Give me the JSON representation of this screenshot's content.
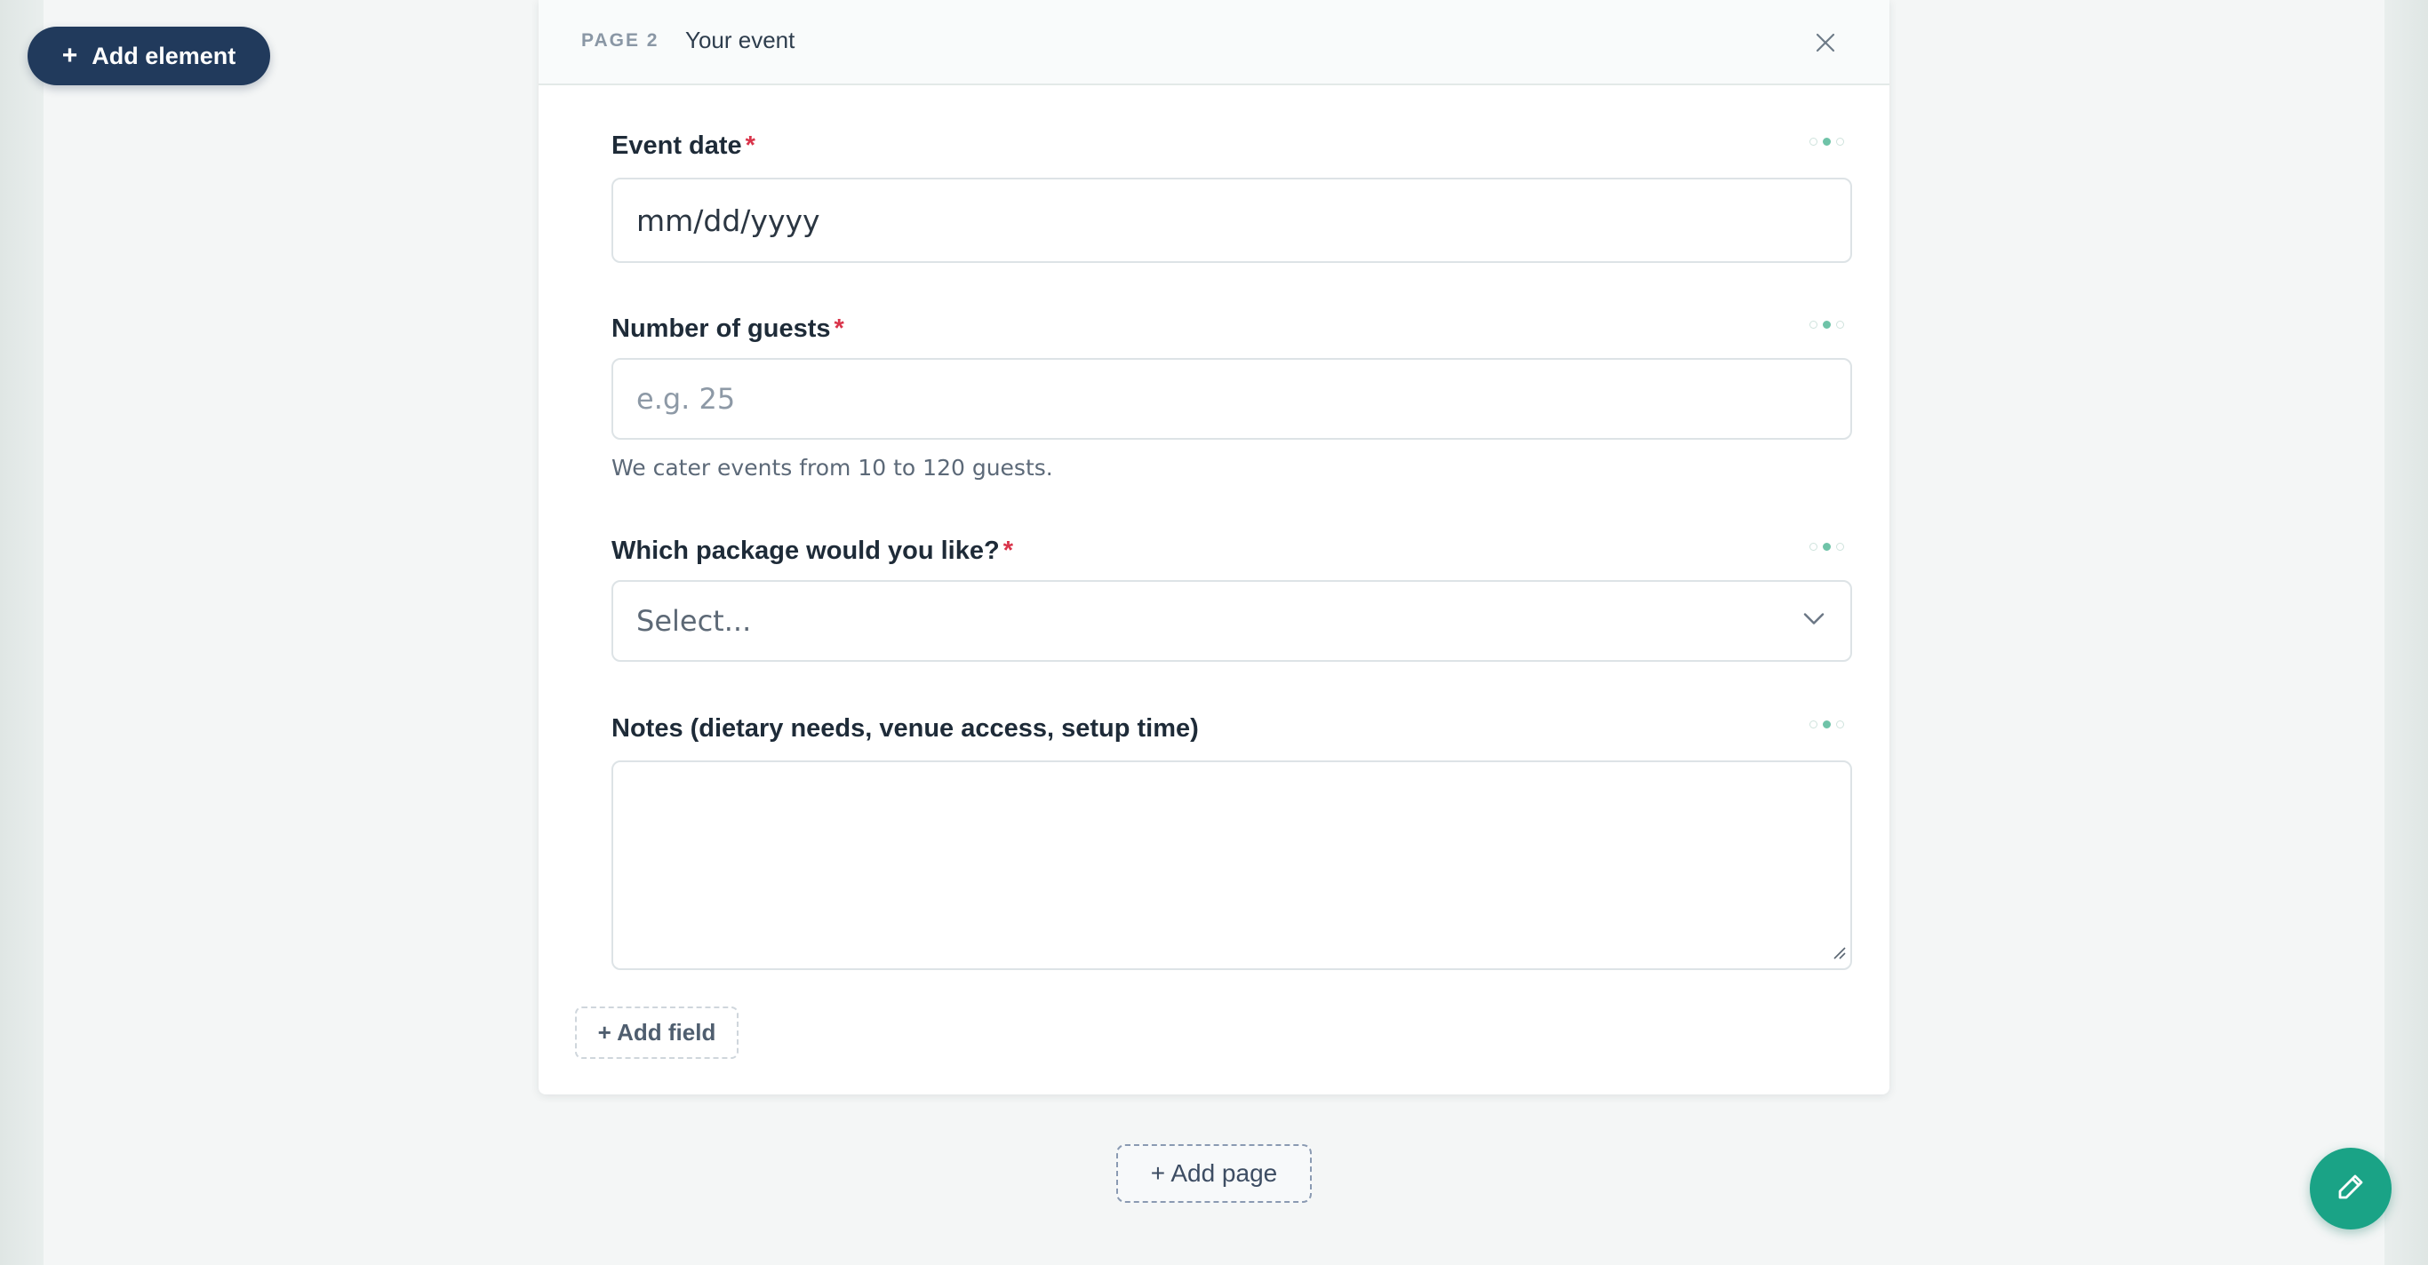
{
  "toolbar": {
    "add_element_icon": "plus-icon",
    "add_element_plus": "+",
    "add_element_label": "Add element"
  },
  "page": {
    "number_label": "PAGE 2",
    "title": "Your event",
    "close_icon": "close-icon"
  },
  "fields": [
    {
      "label": "Event date",
      "required_mark": "*",
      "value": "mm/dd/yyyy",
      "type": "date"
    },
    {
      "label": "Number of guests",
      "required_mark": "*",
      "placeholder": "e.g. 25",
      "help_text": "We cater events from 10 to 120 guests.",
      "type": "number"
    },
    {
      "label": "Which package would you like?",
      "required_mark": "*",
      "selected": "Select...",
      "type": "select",
      "icon": "chevron-down-icon"
    },
    {
      "label": "Notes (dietary needs, venue access, setup time)",
      "value": "",
      "type": "textarea"
    }
  ],
  "actions": {
    "add_field": "+ Add field",
    "add_page": "+ Add page",
    "edit_icon": "pencil-icon"
  },
  "colors": {
    "primary_dark": "#213a5c",
    "accent": "#1aa386",
    "required": "#d9344a"
  }
}
